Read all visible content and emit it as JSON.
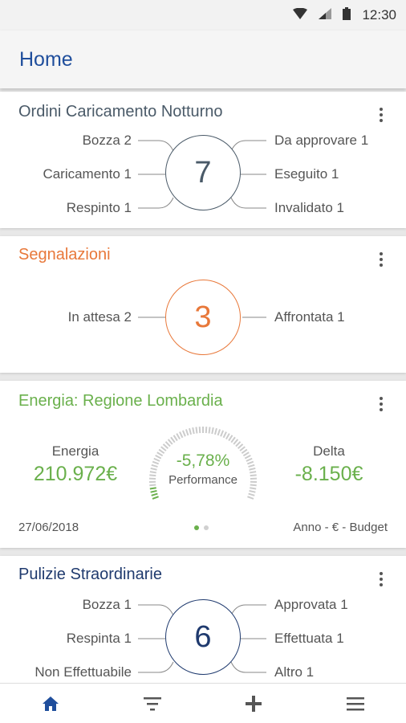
{
  "status_bar": {
    "time": "12:30"
  },
  "app_bar": {
    "title": "Home"
  },
  "cards": {
    "ordini": {
      "title": "Ordini Caricamento Notturno",
      "total": "7",
      "left": [
        "Bozza 2",
        "Caricamento 1",
        "Respinto 1"
      ],
      "right": [
        "Da approvare 1",
        "Eseguito 1",
        "Invalidato 1"
      ],
      "accent": "#4a5a68"
    },
    "segnalazioni": {
      "title": "Segnalazioni",
      "total": "3",
      "left": [
        "In attesa 2"
      ],
      "right": [
        "Affrontata 1"
      ],
      "accent": "#e8783a"
    },
    "energia": {
      "title": "Energia: Regione Lombardia",
      "energy_label": "Energia",
      "energy_value": "210.972€",
      "delta_label": "Delta",
      "delta_value": "-8.150€",
      "gauge_value": "-5,78%",
      "gauge_label": "Performance",
      "gauge_fill_fraction": 0.06,
      "date": "27/06/2018",
      "footer_right": "Anno - € - Budget",
      "accent": "#6ab04c",
      "page_indicator": {
        "count": 2,
        "active": 0
      }
    },
    "pulizie": {
      "title": "Pulizie Straordinarie",
      "total": "6",
      "left": [
        "Bozza 1",
        "Respinta 1",
        "Non Effettuabile"
      ],
      "right": [
        "Approvata 1",
        "Effettuata 1",
        "Altro 1"
      ],
      "accent": "#1f3a6e"
    }
  },
  "bottom_nav": [
    {
      "icon": "home-icon",
      "active": true
    },
    {
      "icon": "filter-icon",
      "active": false
    },
    {
      "icon": "plus-icon",
      "active": false
    },
    {
      "icon": "menu-icon",
      "active": false
    }
  ],
  "colors": {
    "primary": "#1f4e9c",
    "gauge_track": "#cccccc"
  }
}
